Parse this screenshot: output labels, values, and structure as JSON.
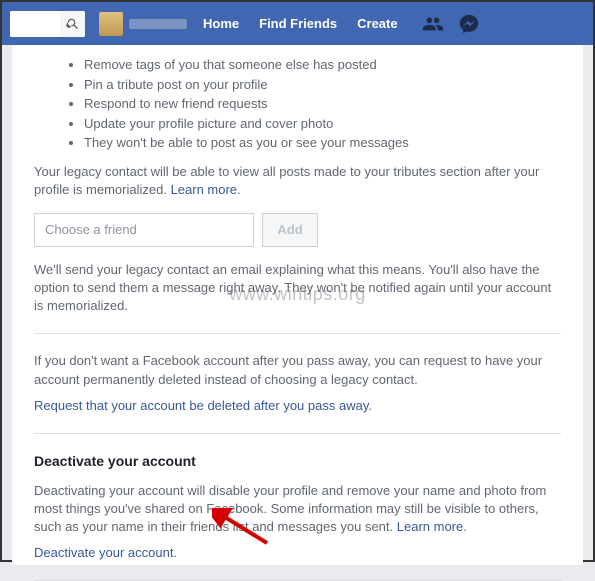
{
  "topbar": {
    "nav": {
      "home": "Home",
      "find_friends": "Find Friends",
      "create": "Create"
    }
  },
  "legacy": {
    "bullets": [
      "Remove tags of you that someone else has posted",
      "Pin a tribute post on your profile",
      "Respond to new friend requests",
      "Update your profile picture and cover photo",
      "They won't be able to post as you or see your messages"
    ],
    "tribute_note": "Your legacy contact will be able to view all posts made to your tributes section after your profile is memorialized.",
    "learn_more": "Learn more",
    "friend_placeholder": "Choose a friend",
    "add_label": "Add",
    "email_note": "We'll send your legacy contact an email explaining what this means. You'll also have the option to send them a message right away. They won't be notified again until your account is memorialized.",
    "delete_note": "If you don't want a Facebook account after you pass away, you can request to have your account permanently deleted instead of choosing a legacy contact.",
    "delete_link": "Request that your account be deleted after you pass away"
  },
  "deactivate": {
    "title": "Deactivate your account",
    "body": "Deactivating your account will disable your profile and remove your name and photo from most things you've shared on Facebook. Some information may still be visible to others, such as your name in their friends list and messages you sent.",
    "learn_more": "Learn more",
    "link": "Deactivate your account"
  },
  "watermark": "www.wintips.org"
}
